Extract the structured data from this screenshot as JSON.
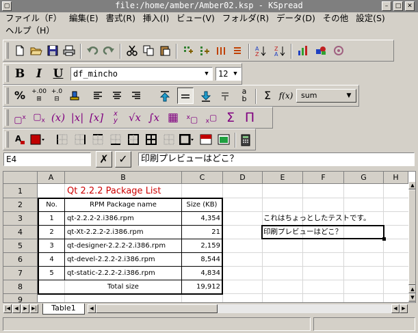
{
  "window": {
    "title": "file:/home/amber/Amber02.ksp - KSpread",
    "buttons": [
      "▢",
      "–",
      "□",
      "✕"
    ]
  },
  "menu": {
    "row1": [
      "ファイル（F）",
      "編集(E)",
      "書式(R)",
      "挿入(I)",
      "ビュー(V)",
      "フォルダ(R)",
      "データ(D)",
      "その他",
      "設定(S)"
    ],
    "row2": [
      "ヘルプ（H）"
    ]
  },
  "format_toolbar": {
    "bold": "B",
    "italic": "I",
    "underline": "U",
    "font": "df_mincho",
    "size": "12"
  },
  "function_toolbar": {
    "sum_symbol": "Σ",
    "fx": "f(x)",
    "function_combo": "sum"
  },
  "formula_bar": {
    "cell_ref": "E4",
    "cancel": "✗",
    "accept": "✓",
    "content": "印刷プレビューはどこ？"
  },
  "sheet": {
    "columns": [
      "A",
      "B",
      "C",
      "D",
      "E",
      "F",
      "G",
      "H"
    ],
    "rows": [
      "1",
      "2",
      "3",
      "4",
      "5",
      "6",
      "7",
      "8",
      "9"
    ],
    "title": "Qt 2.2.2 Package List",
    "table_headers": [
      "No.",
      "RPM Package name",
      "Size (KB)"
    ],
    "table_rows": [
      {
        "no": "1",
        "name": "qt-2.2.2-2.i386.rpm",
        "size": "4,354"
      },
      {
        "no": "2",
        "name": "qt-Xt-2.2.2-2.i386.rpm",
        "size": "21"
      },
      {
        "no": "3",
        "name": "qt-designer-2.2.2-2.i386.rpm",
        "size": "2,159"
      },
      {
        "no": "4",
        "name": "qt-devel-2.2.2-2.i386.rpm",
        "size": "8,544"
      },
      {
        "no": "5",
        "name": "qt-static-2.2.2-2.i386.rpm",
        "size": "4,834"
      }
    ],
    "total_label": "Total size",
    "total_value": "19,912",
    "e3_text": "これはちょっとしたテストです。",
    "e4_text": "印刷プレビューはどこ？"
  },
  "sheet_tabs": [
    "Table1"
  ],
  "colors": {
    "title_red": "#cc0000",
    "formula_purple": "#800080",
    "selection_border": "#000000"
  }
}
